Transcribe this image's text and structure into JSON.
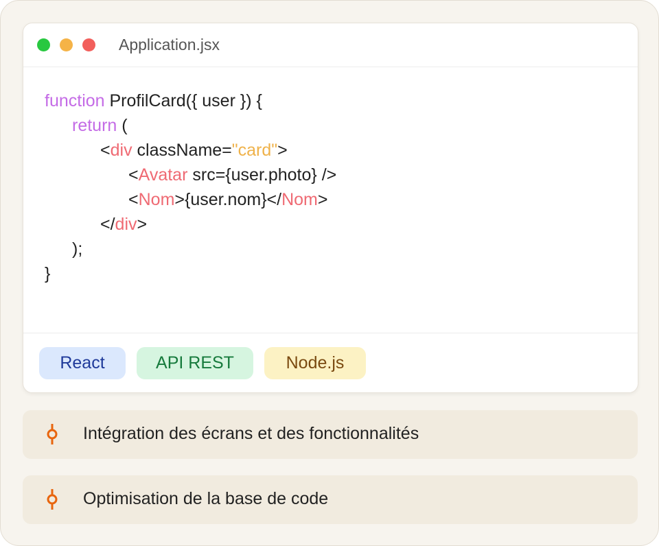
{
  "window": {
    "filename": "Application.jsx",
    "code": {
      "l1_kw": "function",
      "l1_rest": " ProfilCard({ user }) {",
      "l2_kw": "return",
      "l2_rest": " (",
      "l3_a": "<",
      "l3_tag": "div",
      "l3_attr": " className=",
      "l3_str": "\"card\"",
      "l3_end": ">",
      "l4_a": "<",
      "l4_tag": "Avatar",
      "l4_rest": " src={user.photo} />",
      "l5_a": "<",
      "l5_tag1": "Nom",
      "l5_mid": ">{user.nom}</",
      "l5_tag2": "Nom",
      "l5_end": ">",
      "l6_a": "</",
      "l6_tag": "div",
      "l6_end": ">",
      "l7": ");",
      "l8": "}"
    },
    "tags": [
      "React",
      "API REST",
      "Node.js"
    ]
  },
  "items": [
    {
      "label": "Intégration des écrans et des fonctionnalités",
      "icon": "commit-icon"
    },
    {
      "label": "Optimisation de la base de code",
      "icon": "commit-icon"
    }
  ],
  "colors": {
    "keyword": "#c46be6",
    "tag": "#ef6a73",
    "string": "#efb24a",
    "accent": "#e8650e"
  }
}
